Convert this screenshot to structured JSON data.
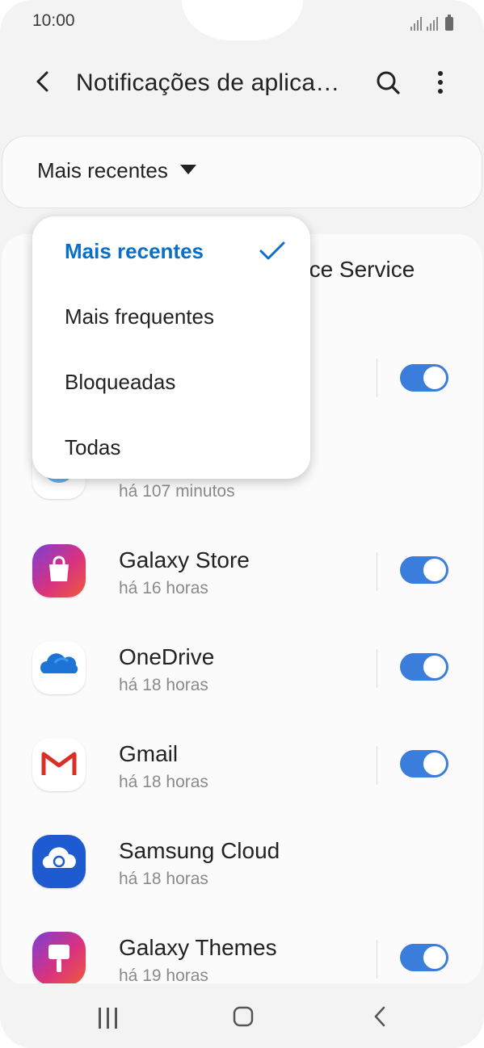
{
  "status_bar": {
    "time": "10:00"
  },
  "header": {
    "title": "Notificações de aplica…"
  },
  "filter": {
    "selected": "Mais recentes"
  },
  "dropdown": {
    "options": [
      "Mais recentes",
      "Mais frequentes",
      "Bloqueadas",
      "Todas"
    ],
    "selected_index": 0
  },
  "hidden_rows": {
    "row1_title_fragment": "nce Service",
    "row3_time": "há 107 minutos"
  },
  "apps": [
    {
      "name": "Galaxy Store",
      "time": "há 16 horas",
      "enabled": true
    },
    {
      "name": "OneDrive",
      "time": "há 18 horas",
      "enabled": true
    },
    {
      "name": "Gmail",
      "time": "há 18 horas",
      "enabled": true
    },
    {
      "name": "Samsung Cloud",
      "time": "há 18 horas",
      "enabled": null
    },
    {
      "name": "Galaxy Themes",
      "time": "há 19 horas",
      "enabled": true
    }
  ],
  "colors": {
    "accent": "#0a6fc6",
    "toggle_on": "#3b7ddb"
  }
}
